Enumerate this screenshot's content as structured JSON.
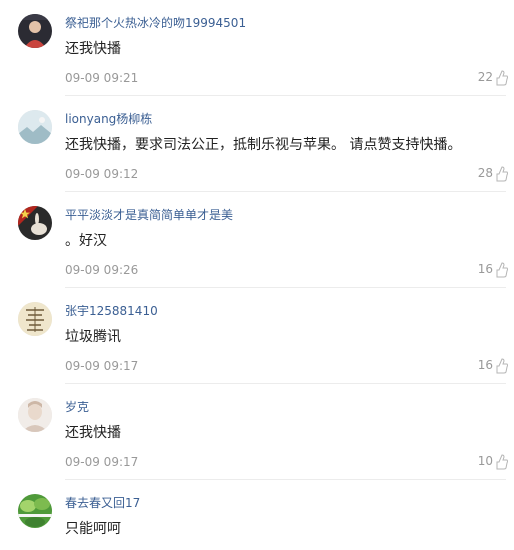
{
  "comments": [
    {
      "username": "祭祀那个火热冰冷的吻19994501",
      "content": "还我快播",
      "time": "09-09 09:21",
      "likes": "22",
      "avatar_icon": "avatar-photo-person-dark",
      "avatar_colors": [
        "#2b2b33",
        "#c9443e"
      ]
    },
    {
      "username": "lionyang杨柳栋",
      "content": "还我快播，要求司法公正，抵制乐视与苹果。 请点赞支持快播。",
      "time": "09-09 09:12",
      "likes": "28",
      "avatar_icon": "avatar-landscape-pale",
      "avatar_colors": [
        "#dde9ee",
        "#9fbcc6"
      ]
    },
    {
      "username": "平平淡淡才是真简简单单才是美",
      "content": "。好汉",
      "time": "09-09 09:26",
      "likes": "16",
      "avatar_icon": "avatar-star-rabbit",
      "avatar_colors": [
        "#b3261e",
        "#f3d34a"
      ]
    },
    {
      "username": "张宇125881410",
      "content": "垃圾腾讯",
      "time": "09-09 09:17",
      "likes": "16",
      "avatar_icon": "avatar-calligraphy",
      "avatar_colors": [
        "#efe6cc",
        "#6e5a3a"
      ]
    },
    {
      "username": "岁克",
      "content": "还我快播",
      "time": "09-09 09:17",
      "likes": "10",
      "avatar_icon": "avatar-photo-person-light",
      "avatar_colors": [
        "#f1ece8",
        "#d8c7bb"
      ]
    },
    {
      "username": "春去春又回17",
      "content": "只能呵呵",
      "time": "",
      "likes": "",
      "avatar_icon": "avatar-green-leaves",
      "avatar_colors": [
        "#4f9a3a",
        "#a3d46b"
      ]
    }
  ],
  "like_icon": "thumbs-up-icon",
  "colors": {
    "username": "#3b5f93",
    "content": "#222222",
    "meta": "#999999"
  }
}
